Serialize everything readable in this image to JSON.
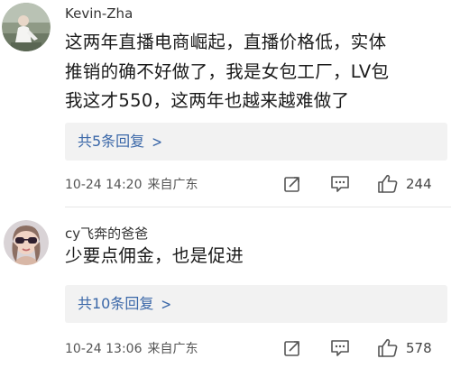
{
  "comments": [
    {
      "username": "Kevin-Zha",
      "lines": [
        "这两年直播电商崛起，直播价格低，实体",
        "推销的确不好做了，我是女包工厂，LV包",
        "我这才550，这两年也越来越难做了"
      ],
      "replies_label": "共5条回复",
      "timestamp": "10-24 14:20",
      "source": "来自广东",
      "likes": "244",
      "icons": [
        "share-icon",
        "comment-icon",
        "thumbs-up-icon"
      ]
    },
    {
      "username": "cy飞奔的爸爸",
      "lines": [
        "少要点佣金，也是促进"
      ],
      "replies_label": "共10条回复",
      "timestamp": "10-24 13:06",
      "source": "来自广东",
      "likes": "578",
      "icons": [
        "share-icon",
        "comment-icon",
        "thumbs-up-icon"
      ]
    }
  ],
  "colors": {
    "link": "#3a67a8",
    "reply_bg": "#f2f2f2",
    "meta": "#555555"
  }
}
